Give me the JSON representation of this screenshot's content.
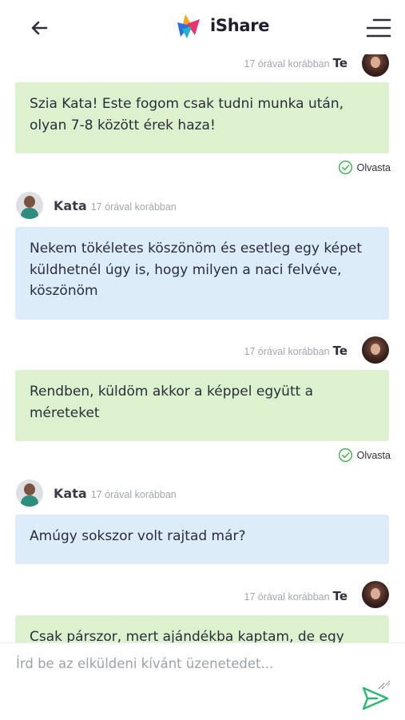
{
  "header": {
    "back_icon": "arrow-left-icon",
    "brand": "iShare",
    "menu_icon": "hamburger-menu-icon",
    "logo_colors": [
      "#f5a623",
      "#2f6fe0",
      "#e8336d",
      "#1bb4c9"
    ]
  },
  "messages": [
    {
      "sender": "me",
      "sender_label": "Te",
      "time": "17 órával korábban",
      "text": "Szia Kata! Este fogom csak tudni munka után, olyan 7-8 között érek haza!",
      "status": "Olvasta"
    },
    {
      "sender": "other",
      "sender_label": "Kata",
      "time": "17 órával korábban",
      "text": "Nekem tökéletes köszönöm és esetleg egy képet küldhetnél úgy is, hogy milyen a naci felvéve, köszönöm"
    },
    {
      "sender": "me",
      "sender_label": "Te",
      "time": "17 órával korábban",
      "text": "Rendben, küldöm akkor a képpel együtt a méreteket",
      "status": "Olvasta"
    },
    {
      "sender": "other",
      "sender_label": "Kata",
      "time": "17 órával korábban",
      "text": "Amúgy sokszor volt rajtad már?"
    },
    {
      "sender": "me",
      "sender_label": "Te",
      "time": "17 órával korábban",
      "text": "Csak párszor, mert ajándékba kaptam, de egy"
    }
  ],
  "composer": {
    "placeholder": "Írd be az elküldeni kívánt üzenetedet...",
    "value": "",
    "send_icon": "send-icon"
  },
  "colors": {
    "mine_bubble": "#dcf1cd",
    "other_bubble": "#dcecf9",
    "send_accent": "#2bb673",
    "read_check": "#4cb45c"
  }
}
